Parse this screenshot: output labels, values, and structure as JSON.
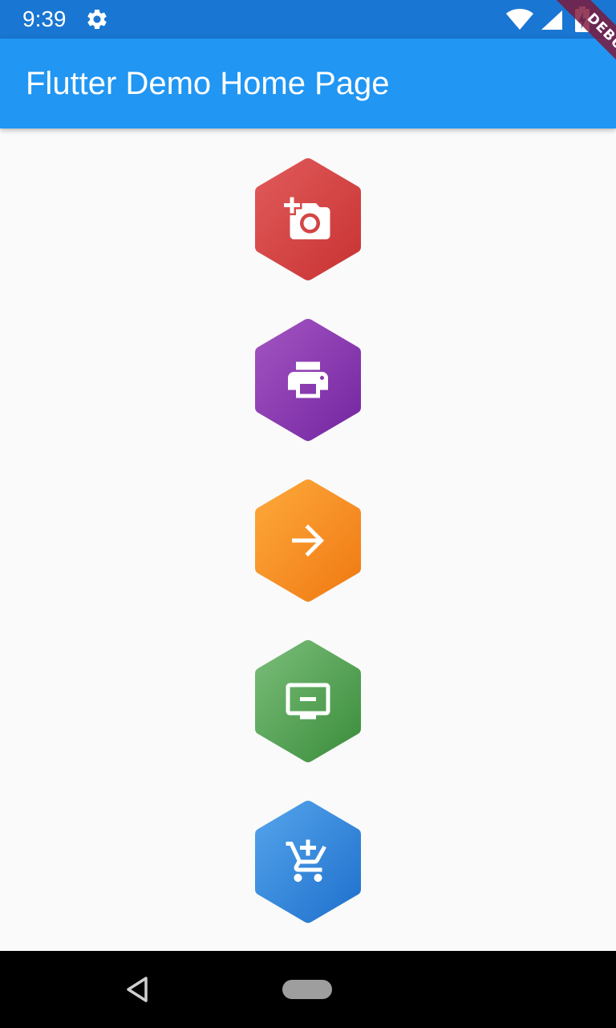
{
  "status_bar": {
    "time": "9:39",
    "icons": [
      "gear-icon",
      "wifi-icon",
      "signal-icon",
      "battery-charging-icon"
    ]
  },
  "app_bar": {
    "title": "Flutter Demo Home Page",
    "color": "#2196f3"
  },
  "debug_banner": {
    "label": "DEBUG"
  },
  "buttons": [
    {
      "icon": "add-a-photo-icon",
      "color_top": "#e15b5b",
      "color_bottom": "#c83232"
    },
    {
      "icon": "print-icon",
      "color_top": "#a455c2",
      "color_bottom": "#7325a0"
    },
    {
      "icon": "arrow-forward-icon",
      "color_top": "#fdaa3c",
      "color_bottom": "#f07812"
    },
    {
      "icon": "remove-from-queue-icon",
      "color_top": "#7bbe7b",
      "color_bottom": "#3a8c3a"
    },
    {
      "icon": "add-shopping-cart-icon",
      "color_top": "#55a5ec",
      "color_bottom": "#1e6fcc"
    }
  ],
  "nav_bar": {
    "icons": [
      "back-icon",
      "home-pill"
    ]
  }
}
